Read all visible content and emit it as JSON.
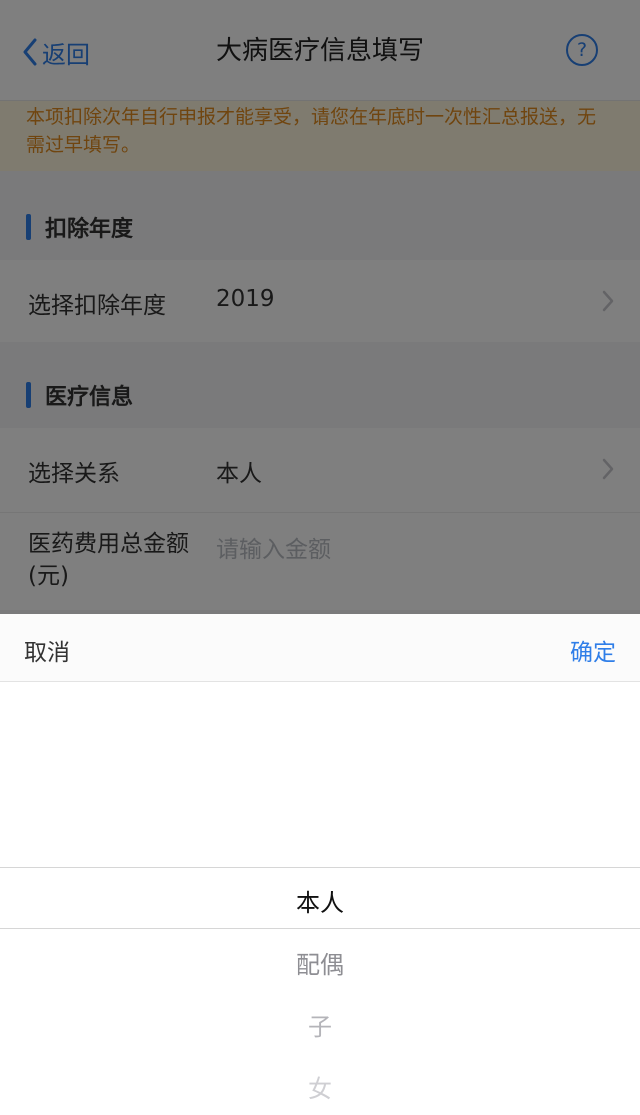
{
  "nav": {
    "back_label": "返回",
    "title": "大病医疗信息填写",
    "help_symbol": "?"
  },
  "notice": {
    "text": "本项扣除次年自行申报才能享受，请您在年底时一次性汇总报送，无需过早填写。"
  },
  "sections": {
    "deduction_year": {
      "title": "扣除年度",
      "row_label": "选择扣除年度",
      "row_value": "2019"
    },
    "medical_info": {
      "title": "医疗信息",
      "relation_label": "选择关系",
      "relation_value": "本人",
      "amount_label": "医药费用总金额(元)",
      "amount_placeholder": "请输入金额"
    }
  },
  "picker": {
    "cancel_label": "取消",
    "confirm_label": "确定",
    "options": [
      "本人",
      "配偶",
      "子",
      "女"
    ],
    "selected_index": 0
  },
  "colors": {
    "accent": "#2f7ee8",
    "notice_text": "#e08a1e",
    "notice_bg": "#fff7df"
  }
}
